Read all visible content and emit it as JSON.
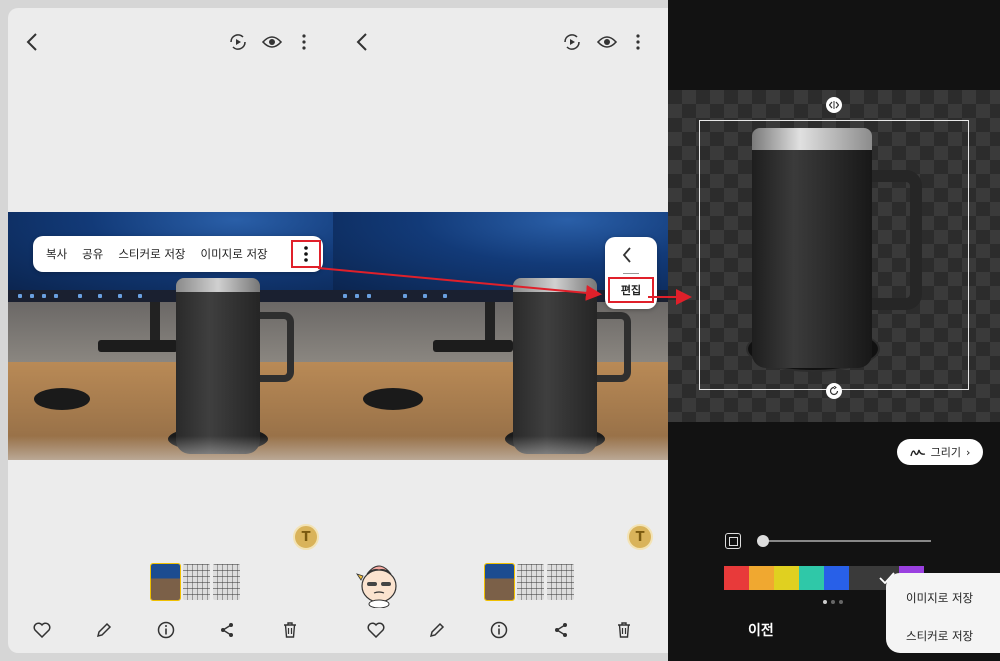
{
  "panel1": {
    "context_menu": {
      "items": [
        "복사",
        "공유",
        "스티커로 저장",
        "이미지로 저장"
      ]
    },
    "t_badge": "T"
  },
  "panel2": {
    "popup_edit": "편집",
    "t_badge": "T"
  },
  "panel3": {
    "draw_button": "그리기",
    "palette": [
      "#e83a3a",
      "#f0a830",
      "#e0d020",
      "#2fc8a8",
      "#2860e8",
      "#3a3a3a",
      "#e8e8e8",
      "#9a40e0"
    ],
    "prev_label": "이전",
    "save_menu": {
      "save_image": "이미지로 저장",
      "save_sticker": "스티커로 저장"
    }
  },
  "colors": {
    "highlight": "#e0202a",
    "arrow": "#e0202a"
  }
}
